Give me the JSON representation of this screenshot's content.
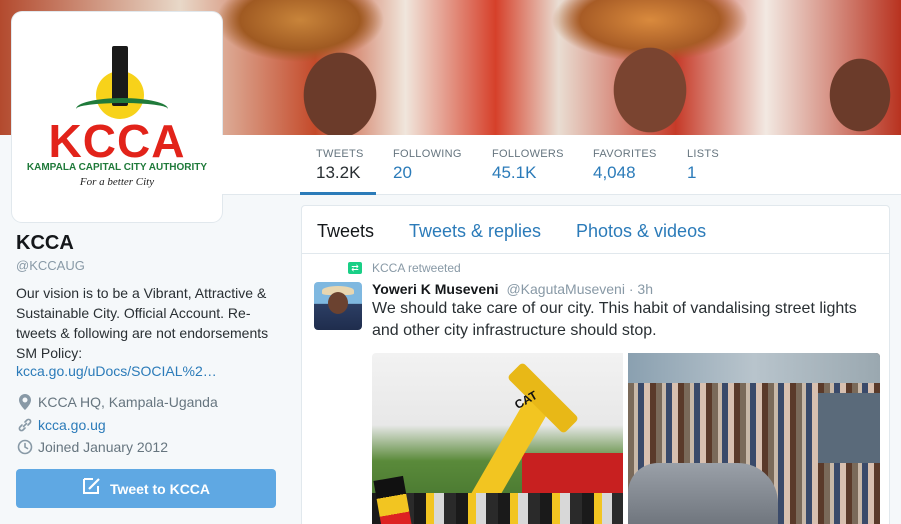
{
  "profile": {
    "logo_text": "KCCA",
    "logo_subtitle": "KAMPALA CAPITAL CITY AUTHORITY",
    "logo_tagline": "For a better City",
    "name": "KCCA",
    "handle": "@KCCAUG",
    "bio": "Our vision is to be a Vibrant, Attractive & Sustainable City. Official Account. Re-tweets & following are not endorsements SM Policy:",
    "bio_link": "kcca.go.ug/uDocs/SOCIAL%2…",
    "location": "KCCA HQ, Kampala-Uganda",
    "website": "kcca.go.ug",
    "joined": "Joined January 2012",
    "tweet_button": "Tweet to KCCA"
  },
  "stats": [
    {
      "label": "TWEETS",
      "value": "13.2K"
    },
    {
      "label": "FOLLOWING",
      "value": "20"
    },
    {
      "label": "FOLLOWERS",
      "value": "45.1K"
    },
    {
      "label": "FAVORITES",
      "value": "4,048"
    },
    {
      "label": "LISTS",
      "value": "1"
    }
  ],
  "tabs": [
    {
      "label": "Tweets"
    },
    {
      "label": "Tweets & replies"
    },
    {
      "label": "Photos & videos"
    }
  ],
  "tweet": {
    "retweet_label": "KCCA retweeted",
    "author_name": "Yoweri K Museveni",
    "author_handle": "@KagutaMuseveni",
    "time": "· 3h",
    "text": "We should take care of our city. This habit of vandalising street lights and other city infrastructure should stop.",
    "media_text": "CAT"
  },
  "colors": {
    "accent": "#2b7bb9",
    "button": "#5fa8e3",
    "retweet_green": "#19cf86",
    "logo_red": "#e2231a",
    "logo_green": "#1f7a3a"
  },
  "icons": {
    "location": "location-pin-icon",
    "link": "link-icon",
    "calendar": "clock-icon",
    "compose": "compose-icon",
    "retweet": "retweet-icon"
  }
}
